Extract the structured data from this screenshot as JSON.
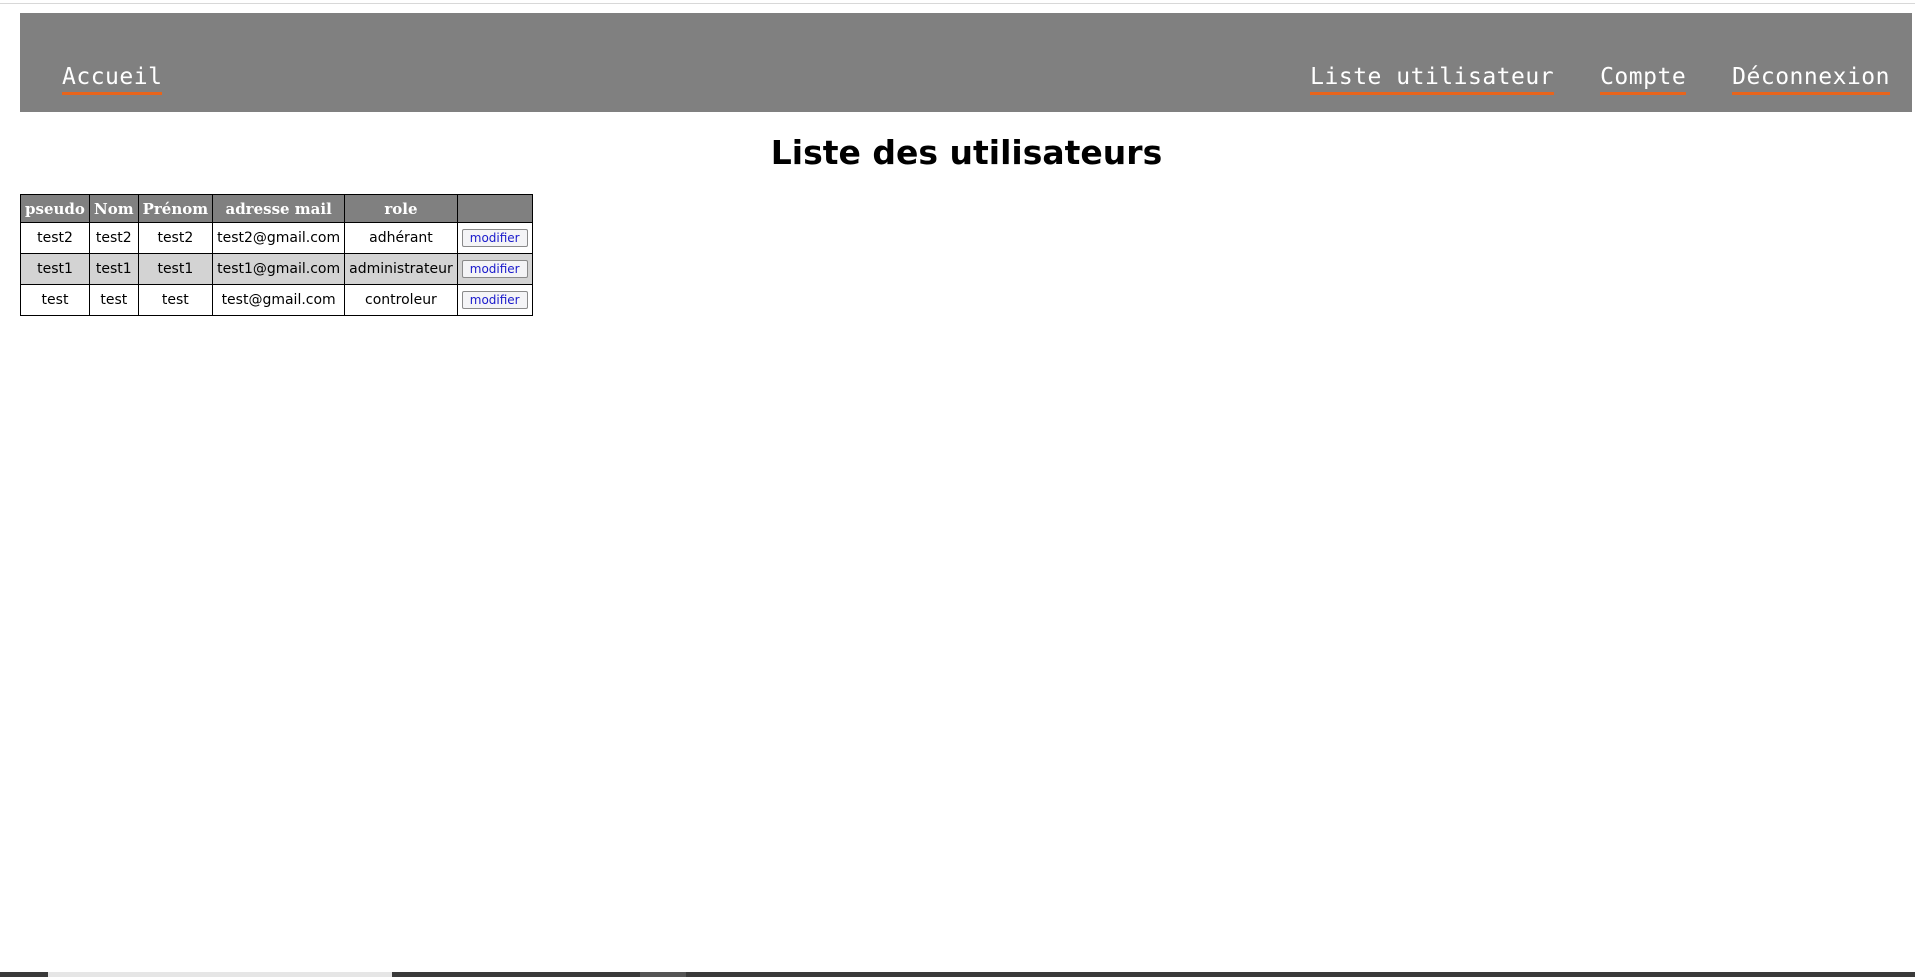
{
  "nav": {
    "home": "Accueil",
    "links": [
      "Liste utilisateur",
      "Compte",
      "Déconnexion"
    ]
  },
  "page_title": "Liste des utilisateurs",
  "table": {
    "headers": [
      "pseudo",
      "Nom",
      "Prénom",
      "adresse mail",
      "role",
      ""
    ],
    "rows": [
      {
        "pseudo": "test2",
        "nom": "test2",
        "prenom": "test2",
        "email": "test2@gmail.com",
        "role": "adhérant",
        "action": "modifier"
      },
      {
        "pseudo": "test1",
        "nom": "test1",
        "prenom": "test1",
        "email": "test1@gmail.com",
        "role": "administrateur",
        "action": "modifier"
      },
      {
        "pseudo": "test",
        "nom": "test",
        "prenom": "test",
        "email": "test@gmail.com",
        "role": "controleur",
        "action": "modifier"
      }
    ]
  },
  "colors": {
    "navbar_bg": "#808080",
    "link_underline": "#e8641c",
    "header_bg": "#808080",
    "alt_row_bg": "#d3d3d3",
    "button_text": "#1a1acc"
  }
}
